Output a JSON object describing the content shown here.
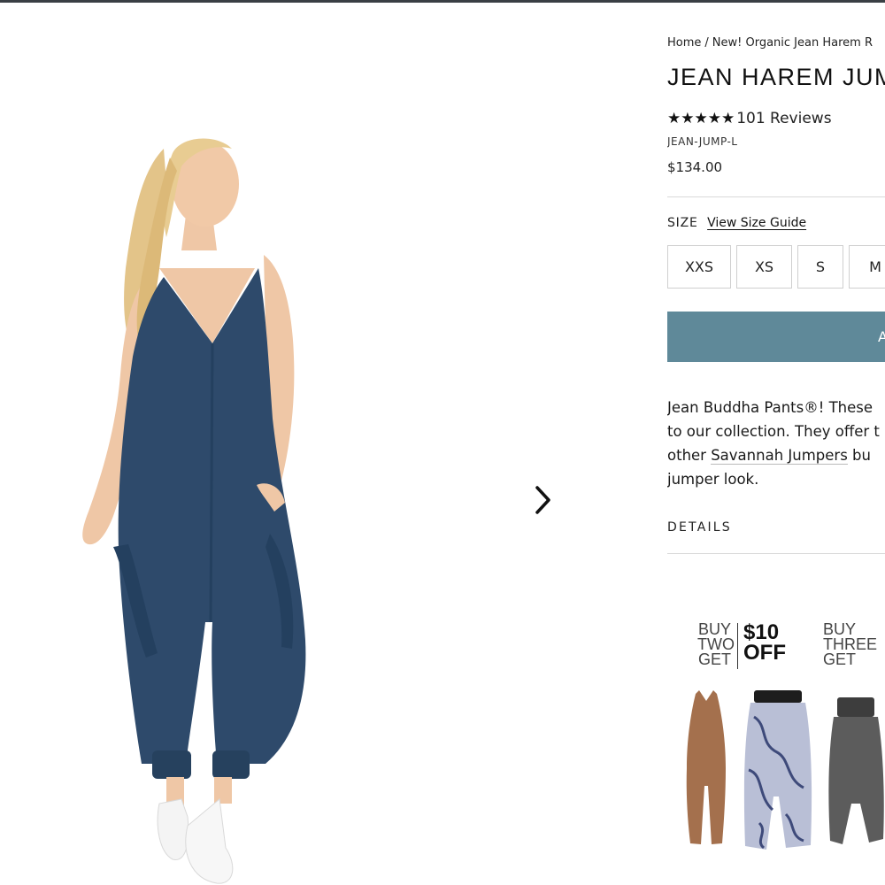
{
  "breadcrumb": {
    "home": "Home",
    "separator": "/",
    "current": "New! Organic Jean Harem R"
  },
  "product": {
    "title": "JEAN HAREM JUMP",
    "stars": "★★★★★",
    "reviews": "101 Reviews",
    "sku": "JEAN-JUMP-L",
    "price": "$134.00"
  },
  "size": {
    "label": "SIZE",
    "guide_link": "View Size Guide",
    "options": [
      "XXS",
      "XS",
      "S",
      "M"
    ]
  },
  "add_to_cart": {
    "label": "A"
  },
  "description": {
    "line1": "Jean Buddha Pants®! These",
    "line2": "to our collection. They offer t",
    "line3_pre": "other ",
    "line3_link": "Savannah Jumpers",
    "line3_post": " bu",
    "line4": "jumper look."
  },
  "details": {
    "label": "DETAILS"
  },
  "promo": {
    "offer1_small": [
      "BUY",
      "TWO",
      "GET"
    ],
    "offer1_big": [
      "$10",
      "OFF"
    ],
    "offer2_small": [
      "BUY",
      "THREE",
      "GET"
    ]
  },
  "colors": {
    "accent": "#5f8999",
    "jumpsuit": "#2e4a6b"
  },
  "icons": {
    "next": "chevron-right-icon",
    "star": "star-icon"
  }
}
